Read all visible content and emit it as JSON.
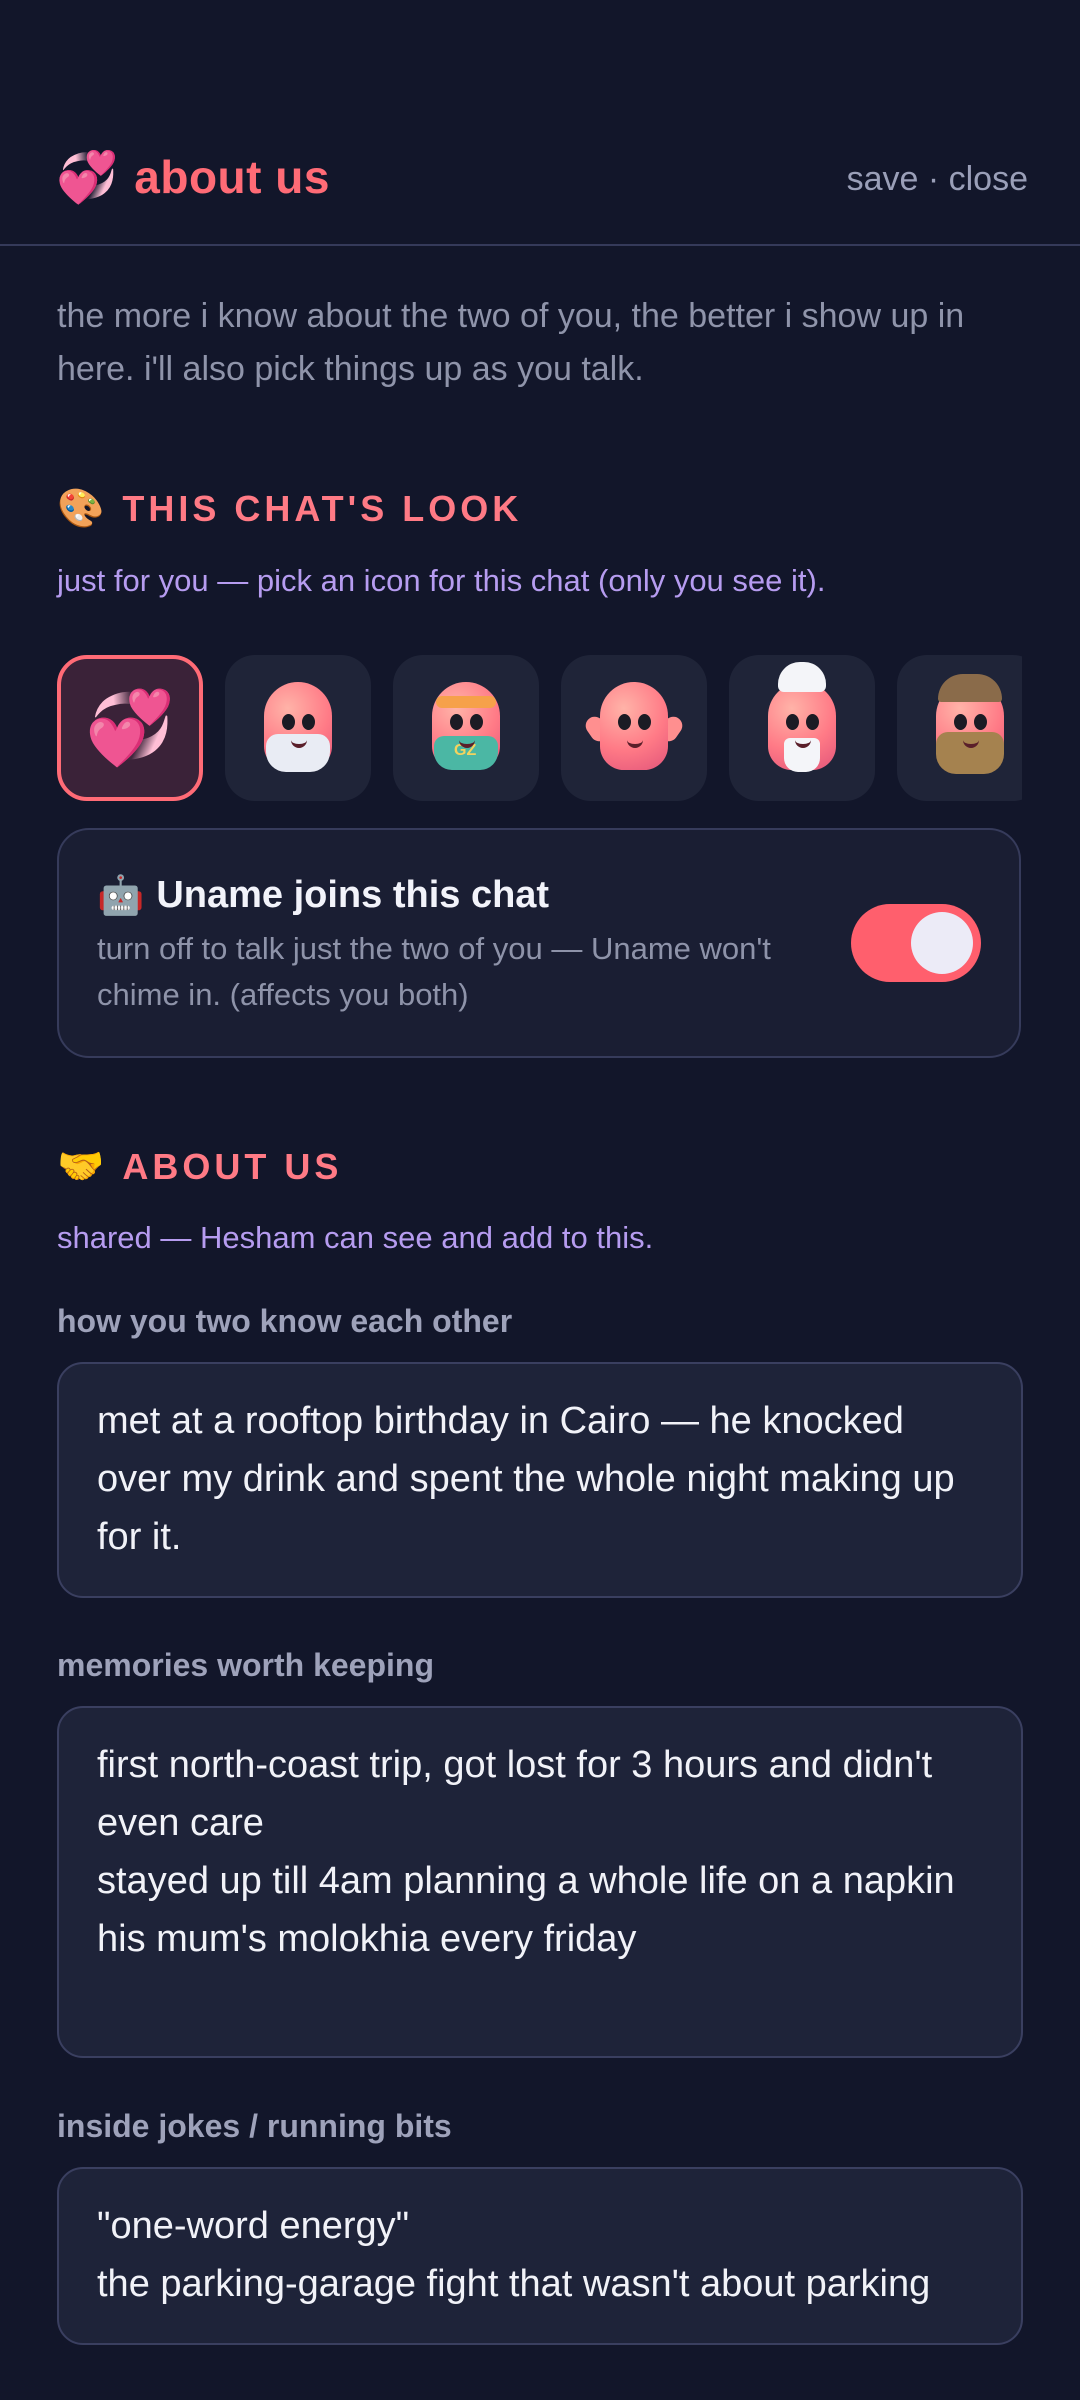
{
  "header": {
    "title_icon": "💞",
    "title": "about us",
    "save_label": "save",
    "separator": " · ",
    "close_label": "close"
  },
  "intro": "the more i know about the two of you, the better i show up in here. i'll also pick things up as you talk.",
  "look_section": {
    "icon": "🎨",
    "title": "THIS CHAT'S LOOK",
    "subtitle": "just for you — pick an icon for this chat (only you see it).",
    "icons": [
      {
        "name": "two-hearts-icon",
        "glyph": "💞",
        "selected": true
      },
      {
        "name": "astronaut-mascot-icon",
        "selected": false
      },
      {
        "name": "sporty-mascot-icon",
        "label": "GZ",
        "selected": false
      },
      {
        "name": "happy-mascot-icon",
        "selected": false
      },
      {
        "name": "chef-mascot-icon",
        "selected": false
      },
      {
        "name": "detective-mascot-icon",
        "selected": false
      }
    ]
  },
  "toggle": {
    "icon": "🤖",
    "title": "Uname joins this chat",
    "description": "turn off to talk just the two of you — Uname won't chime in. (affects you both)",
    "on": true,
    "on_color": "#ff5f6d"
  },
  "about_section": {
    "icon": "🤝",
    "title": "ABOUT US",
    "subtitle": "shared — Hesham can see and add to this."
  },
  "fields": [
    {
      "label": "how you two know each other",
      "value": "met at a rooftop birthday in Cairo — he knocked over my drink and spent the whole night making up for it."
    },
    {
      "label": "memories worth keeping",
      "value": "first north-coast trip, got lost for 3 hours and didn't even care\nstayed up till 4am planning a whole life on a napkin\nhis mum's molokhia every friday"
    },
    {
      "label": "inside jokes / running bits",
      "value": "\"one-word energy\"\nthe parking-garage fight that wasn't about parking"
    }
  ],
  "colors": {
    "background": "#12162a",
    "accent": "#ff6b76",
    "subtitle": "#b69cf0"
  }
}
